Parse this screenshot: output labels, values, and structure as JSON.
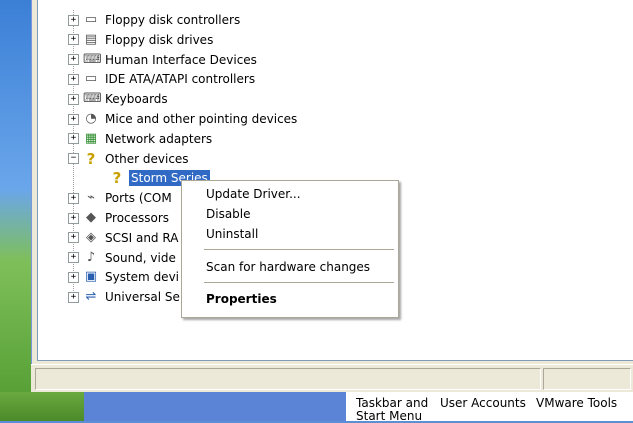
{
  "tree": {
    "items": [
      {
        "label": "Floppy disk controllers",
        "expander": "+",
        "icon": "floppy-controller-icon",
        "glyph": "▭"
      },
      {
        "label": "Floppy disk drives",
        "expander": "+",
        "icon": "floppy-drive-icon",
        "glyph": "▤"
      },
      {
        "label": "Human Interface Devices",
        "expander": "+",
        "icon": "hid-icon",
        "glyph": "⌨"
      },
      {
        "label": "IDE ATA/ATAPI controllers",
        "expander": "+",
        "icon": "ide-controller-icon",
        "glyph": "▭"
      },
      {
        "label": "Keyboards",
        "expander": "+",
        "icon": "keyboard-icon",
        "glyph": "⌨"
      },
      {
        "label": "Mice and other pointing devices",
        "expander": "+",
        "icon": "mouse-icon",
        "glyph": "◔"
      },
      {
        "label": "Network adapters",
        "expander": "+",
        "icon": "network-adapter-icon",
        "glyph": "▦"
      },
      {
        "label": "Other devices",
        "expander": "−",
        "icon": "unknown-device-icon",
        "glyph": "?"
      },
      {
        "label": "Storm Series",
        "expander": "",
        "icon": "unknown-device-warning-icon",
        "glyph": "?"
      },
      {
        "label": "Ports (COM",
        "expander": "+",
        "icon": "port-icon",
        "glyph": "⌁"
      },
      {
        "label": "Processors",
        "expander": "+",
        "icon": "processor-icon",
        "glyph": "◆"
      },
      {
        "label": "SCSI and RA",
        "expander": "+",
        "icon": "scsi-icon",
        "glyph": "◈"
      },
      {
        "label": "Sound, vide",
        "expander": "+",
        "icon": "sound-icon",
        "glyph": "♪"
      },
      {
        "label": "System devi",
        "expander": "+",
        "icon": "system-device-icon",
        "glyph": "▣"
      },
      {
        "label": "Universal Se",
        "expander": "+",
        "icon": "usb-icon",
        "glyph": "⇌"
      }
    ]
  },
  "context_menu": {
    "update_driver": "Update Driver...",
    "disable": "Disable",
    "uninstall": "Uninstall",
    "scan": "Scan for hardware changes",
    "properties": "Properties"
  },
  "control_panel": {
    "taskbar_line1": "Taskbar and",
    "taskbar_line2": "Start Menu",
    "user_accounts": "User Accounts",
    "vmware_tools": "VMware Tools"
  },
  "colors": {
    "selection": "#316ac5",
    "window_face": "#ece9d8",
    "menu_border": "#aca899"
  }
}
